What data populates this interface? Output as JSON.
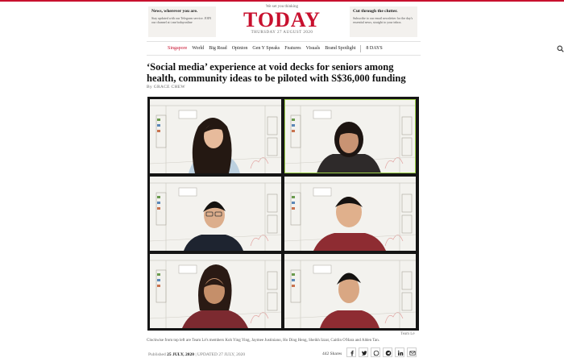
{
  "promos": {
    "left": {
      "title": "News, wherever you are.",
      "text": "Stay updated with our Telegram service. JOIN our channel at t.me/todayonline"
    },
    "right": {
      "title": "Cut through the clutter.",
      "text": "Subscribe to our email newsletter for the day's essential news, straight to your inbox."
    }
  },
  "masthead": {
    "tagline": "We set you thinking",
    "logo": "TODAY",
    "date": "THURSDAY 27 AUGUST 2020"
  },
  "nav": {
    "items": [
      "Singapore",
      "World",
      "Big Read",
      "Opinion",
      "Gen Y Speaks",
      "Features",
      "Visuals",
      "Brand Spotlight"
    ],
    "days": "8 DAYS",
    "search_icon": "search-icon"
  },
  "article": {
    "headline": "‘Social media’ experience at void decks for seniors among health, community ideas to be piloted with S$36,000 funding",
    "byline": "By GRACE CHEW",
    "photo_credit": "Team Lé",
    "caption": "Clockwise from top left are Team Lé's members Koh Ying Ying, Jaymee Justiniano, Ho Ding Heng, Sheikh Izzat, Caitlin O'Hara and Alden Tan.",
    "published_label": "Published",
    "published_date": "25 JULY, 2020",
    "updated_label": "UPDATED 27 JULY, 2020",
    "shares": "442 Shares"
  },
  "video_call": {
    "participants": [
      "Koh Ying Ying",
      "Jaymee Justiniano",
      "Ho Ding Heng",
      "Sheikh Izzat",
      "Caitlin O'Hara",
      "Alden Tan"
    ],
    "active_speaker_color": "#9fd44a"
  },
  "social_icons": [
    "facebook-icon",
    "twitter-icon",
    "whatsapp-icon",
    "telegram-icon",
    "linkedin-icon",
    "email-icon"
  ],
  "colors": {
    "brand": "#c8102e",
    "text": "#1a1a1a",
    "muted": "#666666"
  }
}
